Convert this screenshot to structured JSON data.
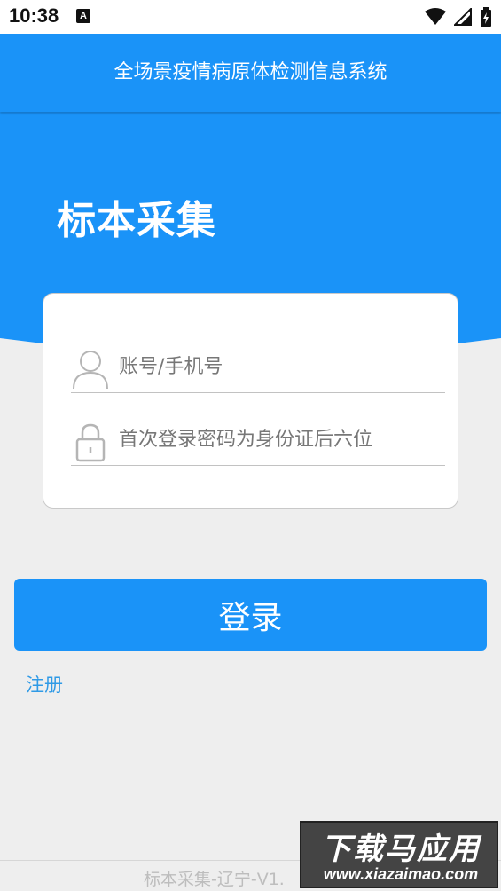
{
  "status_bar": {
    "time": "10:38",
    "notification_badge": "A",
    "icons": [
      "wifi-icon",
      "signal-icon",
      "battery-icon"
    ]
  },
  "header": {
    "title": "全场景疫情病原体检测信息系统"
  },
  "hero": {
    "title": "标本采集"
  },
  "login_form": {
    "username_placeholder": "账号/手机号",
    "password_placeholder": "首次登录密码为身份证后六位",
    "username_icon": "user-icon",
    "password_icon": "lock-icon"
  },
  "actions": {
    "login_label": "登录",
    "register_label": "注册"
  },
  "footer": {
    "version_text": "标本采集-辽宁-V1."
  },
  "watermark": {
    "top": "下载马应用",
    "bottom": "www.xiazaimao.com"
  },
  "colors": {
    "primary": "#1a93f8",
    "background": "#eeeeee",
    "link": "#2f9ae6"
  }
}
